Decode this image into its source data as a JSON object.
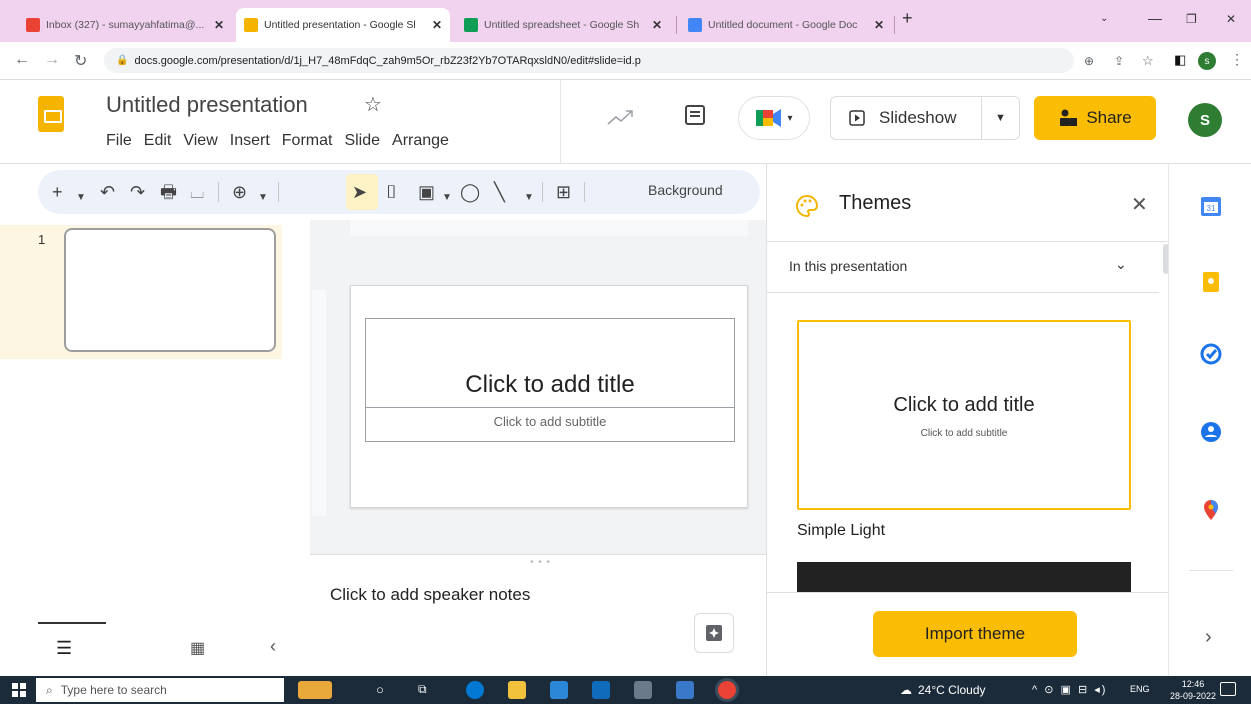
{
  "browser": {
    "tabs": [
      {
        "label": "Inbox (327) - sumayyahfatima@...",
        "color": "#ea4335",
        "active": false
      },
      {
        "label": "Untitled presentation - Google Sl",
        "color": "#f4b400",
        "active": true
      },
      {
        "label": "Untitled spreadsheet - Google Sh",
        "color": "#0f9d58",
        "active": false
      },
      {
        "label": "Untitled document - Google Doc",
        "color": "#4285f4",
        "active": false
      }
    ],
    "tab_close": "✕",
    "new_tab": "+",
    "url": "docs.google.com/presentation/d/1j_H7_48mFdqC_zah9m5Or_rbZ23f2Yb7OTARqxsldN0/edit#slide=id.p",
    "profile_initial": "s"
  },
  "app": {
    "title": "Untitled presentation",
    "menu": [
      "File",
      "Edit",
      "View",
      "Insert",
      "Format",
      "Slide",
      "Arrange"
    ],
    "slideshow_label": "Slideshow",
    "share_label": "Share",
    "avatar_initial": "S",
    "brand_color": "#fbbc04"
  },
  "toolbar": {
    "background_label": "Background"
  },
  "filmstrip": {
    "slide_number": "1"
  },
  "slide": {
    "title_placeholder": "Click to add title",
    "subtitle_placeholder": "Click to add subtitle"
  },
  "notes": {
    "placeholder": "Click to add speaker notes"
  },
  "themes": {
    "title": "Themes",
    "section": "In this presentation",
    "card_title": "Click to add title",
    "card_subtitle": "Click to add subtitle",
    "theme_name": "Simple Light",
    "import_label": "Import theme"
  },
  "taskbar": {
    "search_placeholder": "Type here to search",
    "weather": "24°C  Cloudy",
    "lang": "ENG",
    "time": "12:46",
    "date": "28-09-2022"
  }
}
